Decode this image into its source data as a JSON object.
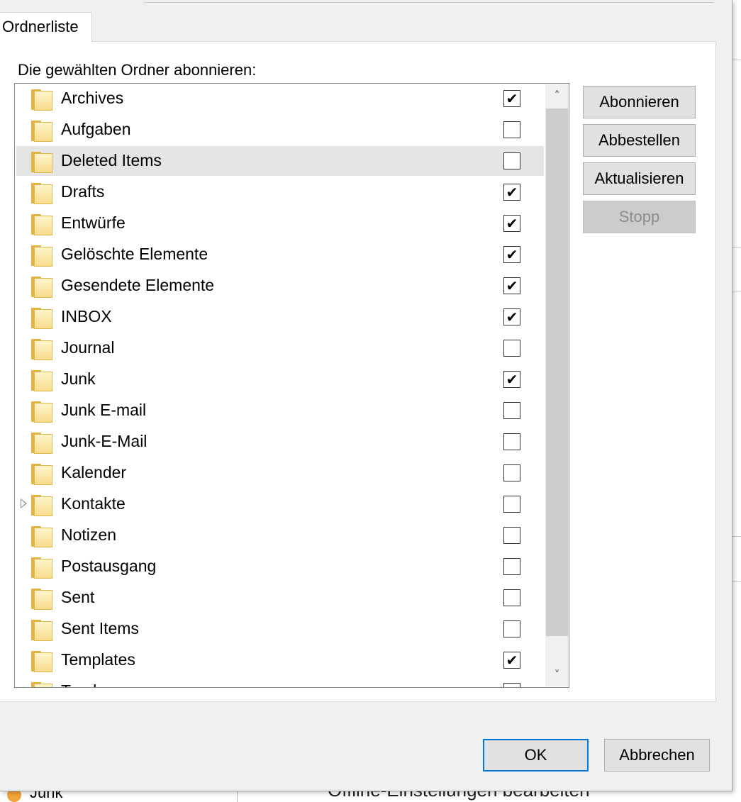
{
  "tab": {
    "label": "Ordnerliste"
  },
  "list": {
    "caption": "Die gewählten Ordner abonnieren:",
    "folders": [
      {
        "name": "Archives",
        "checked": true
      },
      {
        "name": "Aufgaben",
        "checked": false
      },
      {
        "name": "Deleted Items",
        "checked": false,
        "selected": true
      },
      {
        "name": "Drafts",
        "checked": true
      },
      {
        "name": "Entwürfe",
        "checked": true
      },
      {
        "name": "Gelöschte Elemente",
        "checked": true
      },
      {
        "name": "Gesendete Elemente",
        "checked": true
      },
      {
        "name": "INBOX",
        "checked": true
      },
      {
        "name": "Journal",
        "checked": false
      },
      {
        "name": "Junk",
        "checked": true
      },
      {
        "name": "Junk E-mail",
        "checked": false
      },
      {
        "name": "Junk-E-Mail",
        "checked": false
      },
      {
        "name": "Kalender",
        "checked": false
      },
      {
        "name": "Kontakte",
        "checked": false,
        "expandable": true
      },
      {
        "name": "Notizen",
        "checked": false
      },
      {
        "name": "Postausgang",
        "checked": false
      },
      {
        "name": "Sent",
        "checked": false
      },
      {
        "name": "Sent Items",
        "checked": false
      },
      {
        "name": "Templates",
        "checked": true
      },
      {
        "name": "Trash",
        "checked": false
      }
    ]
  },
  "side_buttons": {
    "subscribe": "Abonnieren",
    "unsubscribe": "Abbestellen",
    "refresh": "Aktualisieren",
    "stop": "Stopp"
  },
  "footer": {
    "ok": "OK",
    "cancel": "Abbrechen"
  },
  "background": {
    "junk_label": "Junk",
    "offline_label": "Offline-Einstellungen bearbeiten"
  },
  "icons": {
    "folder": "folder-icon",
    "check": "✔",
    "scroll_up": "˄",
    "scroll_down": "˅"
  }
}
